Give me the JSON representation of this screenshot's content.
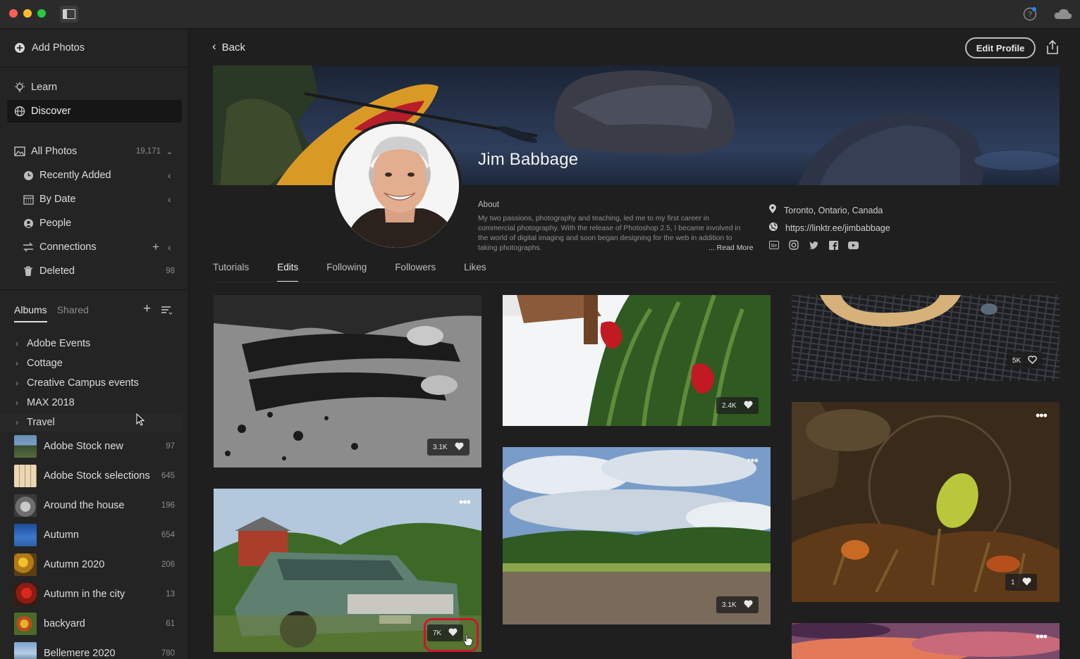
{
  "titlebar": {
    "help_icon": "help-icon",
    "cloud_icon": "cloud-icon"
  },
  "sidebar": {
    "add_photos": "Add Photos",
    "learn": "Learn",
    "discover": "Discover",
    "library": [
      {
        "label": "All Photos",
        "count": "19,171",
        "icon": "photos-icon"
      },
      {
        "label": "Recently Added",
        "count": "",
        "icon": "clock-icon"
      },
      {
        "label": "By Date",
        "count": "",
        "icon": "calendar-icon"
      },
      {
        "label": "People",
        "count": "",
        "icon": "person-icon"
      },
      {
        "label": "Connections",
        "count": "",
        "icon": "connections-icon"
      },
      {
        "label": "Deleted",
        "count": "98",
        "icon": "trash-icon"
      }
    ],
    "albums_tab": "Albums",
    "shared_tab": "Shared",
    "folders": [
      "Adobe Events",
      "Cottage",
      "Creative Campus events",
      "MAX 2018",
      "Travel"
    ],
    "albums": [
      {
        "label": "Adobe Stock new",
        "count": "97"
      },
      {
        "label": "Adobe Stock selections",
        "count": "645"
      },
      {
        "label": "Around the house",
        "count": "196"
      },
      {
        "label": "Autumn",
        "count": "654"
      },
      {
        "label": "Autumn 2020",
        "count": "206"
      },
      {
        "label": "Autumn in the city",
        "count": "13"
      },
      {
        "label": "backyard",
        "count": "61"
      },
      {
        "label": "Bellemere 2020",
        "count": "780"
      }
    ]
  },
  "main": {
    "back_label": "Back",
    "edit_profile": "Edit Profile",
    "profile": {
      "name": "Jim Babbage",
      "about_label": "About",
      "about_text": "My two passions, photography and teaching, led me to my first career in commercial photography. With the release of Photoshop 2.5, I became involved in the world of digital imaging and soon began designing for the web in addition to taking photographs.",
      "read_more": "... Read More",
      "location": "Toronto, Ontario, Canada",
      "website": "https://linktr.ee/jimbabbage",
      "social_icons": [
        "behance-icon",
        "instagram-icon",
        "twitter-icon",
        "facebook-icon",
        "youtube-icon"
      ]
    },
    "tabs": [
      "Tutorials",
      "Edits",
      "Following",
      "Followers",
      "Likes"
    ],
    "active_tab": "Edits",
    "photos": [
      {
        "likes": "3.1K"
      },
      {
        "likes": "7K"
      },
      {
        "likes": "2.4K"
      },
      {
        "likes": "3.1K"
      },
      {
        "likes": "5K"
      },
      {
        "likes": "1"
      }
    ]
  }
}
